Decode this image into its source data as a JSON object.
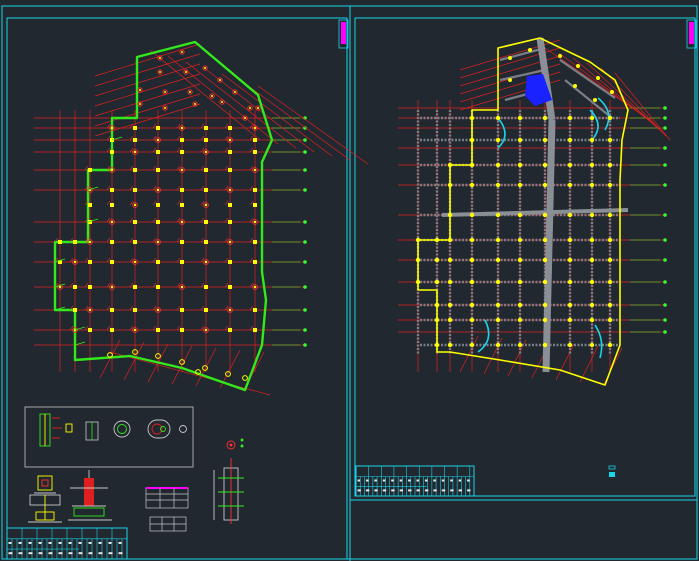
{
  "colors": {
    "background": "#212830",
    "frame": "#19d3e8",
    "boundary": "#34e81c",
    "axis": "#e02020",
    "node": "#ffff00",
    "node_ring": "#ff3030",
    "axis_end": "#2cff2c",
    "beam_grey": "#7a7f86",
    "filled_region": "#1a22ff",
    "marker": "#ff00ff",
    "pipe": "#c8c8c8",
    "text_white": "#e8e8e8"
  },
  "sheets": [
    {
      "name": "left-sheet",
      "title_block_cells": 24,
      "grid_columns": 10,
      "grid_rows": 11
    },
    {
      "name": "right-sheet",
      "title_block_cells": 28,
      "grid_columns": 10,
      "grid_rows": 12
    }
  ],
  "details": {
    "legend_box_items": 4,
    "table_rows": 3
  }
}
